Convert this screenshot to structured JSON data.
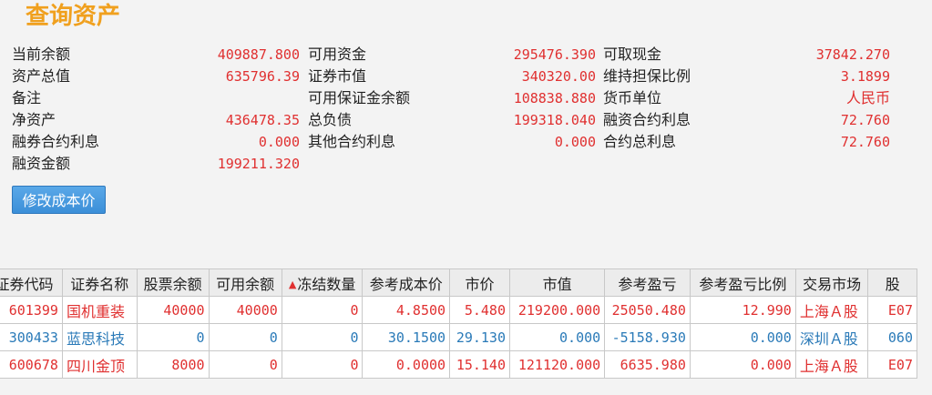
{
  "title": "查询资产",
  "summary": [
    {
      "l1": "当前余额",
      "v1": "409887.800",
      "l2": "可用资金",
      "v2": "295476.390",
      "l3": "可取现金",
      "v3": "37842.270"
    },
    {
      "l1": "资产总值",
      "v1": "635796.39",
      "l2": "证券市值",
      "v2": "340320.00",
      "l3": "维持担保比例",
      "v3": "3.1899"
    },
    {
      "l1": "备注",
      "v1": "",
      "l2": "可用保证金余额",
      "v2": "108838.880",
      "l3": "货币单位",
      "v3": "人民币"
    },
    {
      "l1": "净资产",
      "v1": "436478.35",
      "l2": "总负债",
      "v2": "199318.040",
      "l3": "融资合约利息",
      "v3": "72.760"
    },
    {
      "l1": "融券合约利息",
      "v1": "0.000",
      "l2": "其他合约利息",
      "v2": "0.000",
      "l3": "合约总利息",
      "v3": "72.760"
    },
    {
      "l1": "融资金额",
      "v1": "199211.320",
      "l2": "",
      "v2": "",
      "l3": "",
      "v3": ""
    }
  ],
  "modify_button_label": "修改成本价",
  "table": {
    "columns": [
      "证券代码",
      "证券名称",
      "股票余额",
      "可用余额",
      "冻结数量",
      "参考成本价",
      "市价",
      "市值",
      "参考盈亏",
      "参考盈亏比例",
      "交易市场",
      "股"
    ],
    "sort_indicator": "▲",
    "rows": [
      {
        "color": "red",
        "cells": [
          "601399",
          "国机重装",
          "40000",
          "40000",
          "0",
          "4.8500",
          "5.480",
          "219200.000",
          "25050.480",
          "12.990",
          "上海Ａ股",
          "E07"
        ]
      },
      {
        "color": "blue",
        "cells": [
          "300433",
          "蓝思科技",
          "0",
          "0",
          "0",
          "30.1500",
          "29.130",
          "0.000",
          "-5158.930",
          "0.000",
          "深圳Ａ股",
          "060"
        ]
      },
      {
        "color": "red",
        "cells": [
          "600678",
          "四川金顶",
          "8000",
          "0",
          "0",
          "0.0000",
          "15.140",
          "121120.000",
          "6635.980",
          "0.000",
          "上海Ａ股",
          "E07"
        ]
      }
    ]
  }
}
